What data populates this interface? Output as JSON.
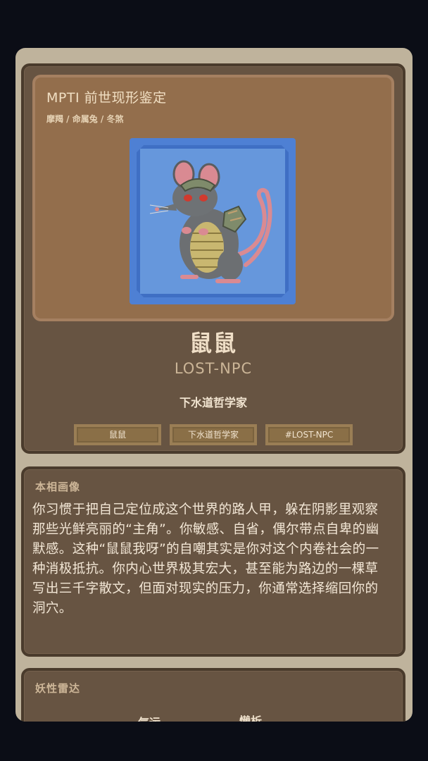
{
  "hero": {
    "title": "MPTI 前世现形鉴定",
    "subtitle": "摩羯 / 命属兔 / 冬煞"
  },
  "profile": {
    "name": "鼠鼠",
    "code": "LOST-NPC",
    "title": "下水道哲学家",
    "tags": [
      "鼠鼠",
      "下水道哲学家",
      "#LOST-NPC"
    ]
  },
  "portrait_section": {
    "label": "本相画像",
    "text": "你习惯于把自己定位成这个世界的路人甲，躲在阴影里观察那些光鲜亮丽的“主角”。你敏感、自省，偶尔带点自卑的幽默感。这种“鼠鼠我呀”的自嘲其实是你对这个内卷社会的一种消极抵抗。你内心世界极其宏大，甚至能为路边的一棵草写出三千字散文，但面对现实的压力，你通常选择缩回你的洞穴。"
  },
  "radar_section": {
    "label": "妖性雷达",
    "axis_labels": [
      "气运",
      "懒析"
    ]
  },
  "colors": {
    "background": "#0b0d16",
    "card": "#675442",
    "hero": "#936e4c",
    "portrait_bg": "#6697dc"
  },
  "icons": {
    "portrait": "armored-rat-illustration"
  }
}
